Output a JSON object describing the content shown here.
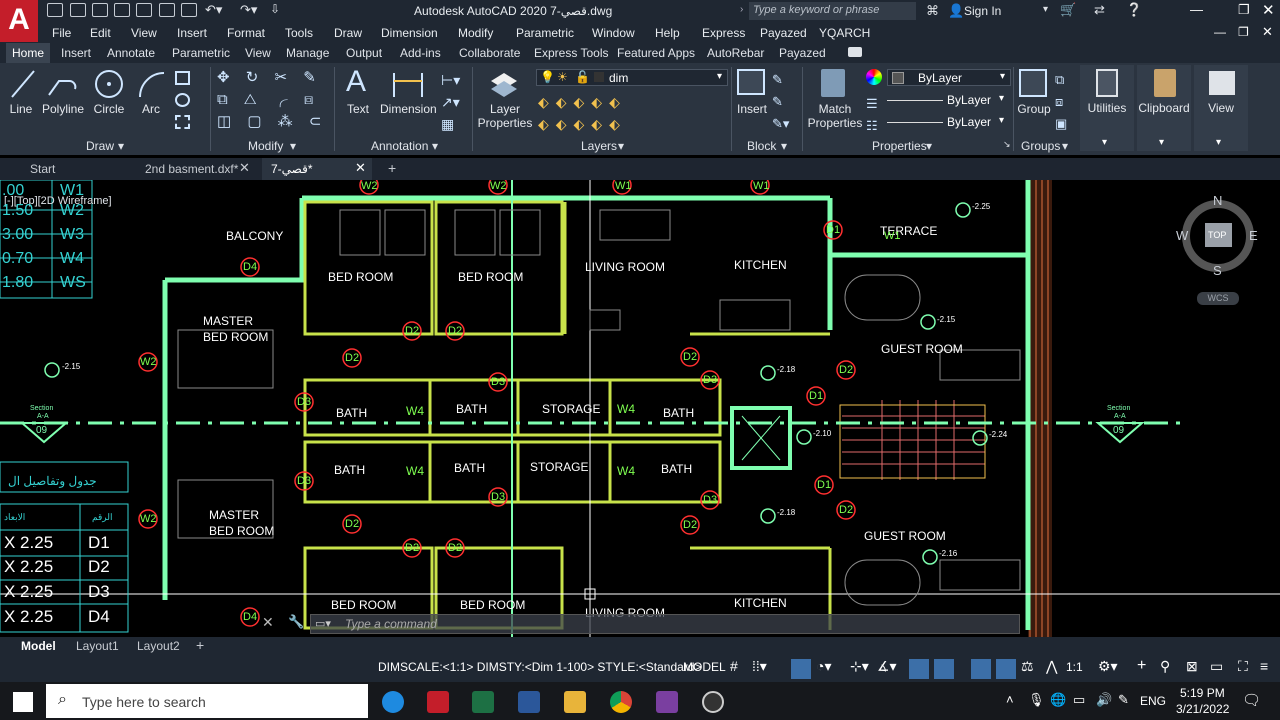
{
  "app": {
    "logo_letter": "A",
    "title": "Autodesk AutoCAD 2020   7-قصي.dwg",
    "search_placeholder": "Type a keyword or phrase",
    "sign_in": "Sign In"
  },
  "menu": [
    "File",
    "Edit",
    "View",
    "Insert",
    "Format",
    "Tools",
    "Draw",
    "Dimension",
    "Modify",
    "Parametric",
    "Window",
    "Help",
    "Express",
    "Payazed",
    "YQARCH"
  ],
  "ribbon_tabs": [
    "Home",
    "Insert",
    "Annotate",
    "Parametric",
    "View",
    "Manage",
    "Output",
    "Add-ins",
    "Collaborate",
    "Express Tools",
    "Featured Apps",
    "AutoRebar",
    "Payazed"
  ],
  "draw": {
    "line": "Line",
    "polyline": "Polyline",
    "circle": "Circle",
    "arc": "Arc",
    "panel": "Draw"
  },
  "modify": {
    "panel": "Modify"
  },
  "annotation": {
    "text": "Text",
    "dimension": "Dimension",
    "panel": "Annotation"
  },
  "layers": {
    "layer_properties": "Layer Properties",
    "current_layer": "dim",
    "panel": "Layers"
  },
  "block": {
    "insert": "Insert",
    "panel": "Block"
  },
  "properties": {
    "match": "Match Properties",
    "color": "ByLayer",
    "linetype": "ByLayer",
    "lineweight": "ByLayer",
    "panel": "Properties"
  },
  "groups": {
    "group": "Group",
    "panel": "Groups"
  },
  "utilities": "Utilities",
  "clipboard": "Clipboard",
  "view": "View",
  "doc_tabs": [
    "Start",
    "2nd basment.dxf*",
    "7-قصي*"
  ],
  "viewport_label": "[-][Top][2D Wireframe]",
  "viewcube": {
    "n": "N",
    "s": "S",
    "e": "E",
    "w": "W",
    "top": "TOP",
    "wcs": "WCS"
  },
  "legend": {
    "rows": [
      ".00",
      "1.50",
      "3.00",
      "0.70",
      "1.80"
    ],
    "codes": [
      "W1",
      "W2",
      "W3",
      "W4",
      "WS"
    ]
  },
  "doors_table": {
    "title": "جدول وتفاصيل ال",
    "col1": "الابعاد",
    "col2": "الرقم",
    "rows": [
      {
        "size": "X 2.25",
        "code": "D1"
      },
      {
        "size": "X 2.25",
        "code": "D2"
      },
      {
        "size": "X 2.25",
        "code": "D3"
      },
      {
        "size": "X 2.25",
        "code": "D4"
      }
    ]
  },
  "rooms": {
    "balcony": "BALCONY",
    "bedroom": "BED ROOM",
    "master": "MASTER",
    "master2": "BED ROOM",
    "living": "LIVING ROOM",
    "kitchen": "KITCHEN",
    "terrace": "TERRACE",
    "guest": "GUEST ROOM",
    "bath": "BATH",
    "storage": "STORAGE"
  },
  "tags": {
    "d1": "D1",
    "d2": "D2",
    "d3": "D3",
    "d4": "D4",
    "w1": "W1",
    "w2": "W2",
    "w4": "W4",
    "section": "Section",
    "section_aa": "A-A",
    "section_no": "09"
  },
  "levels": {
    "l225": "-2.25",
    "l215": "-2.15",
    "l210": "-2.10",
    "l218": "-2.18",
    "l224": "-2.24",
    "l216": "-2.16"
  },
  "command_placeholder": "Type a command",
  "layout_tabs": [
    "Model",
    "Layout1",
    "Layout2"
  ],
  "status": {
    "dimscale": "DIMSCALE:<1:1> DIMSTY:<Dim 1-100> STYLE:<Standard>",
    "model": "MODEL",
    "scale": "1:1"
  },
  "taskbar": {
    "search": "Type here to search",
    "lang": "ENG",
    "time": "5:19 PM",
    "date": "3/21/2022"
  }
}
